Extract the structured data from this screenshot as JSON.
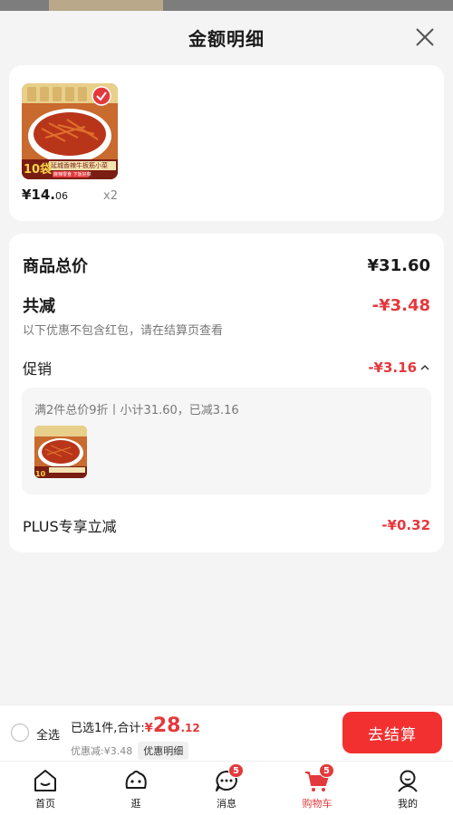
{
  "sheet": {
    "title": "金额明细"
  },
  "product": {
    "image_pack_count": "10袋",
    "image_label": "延城香辣牛板筋小菜",
    "image_sub_label": "麻辣零食 下饭好菜",
    "price_yen": "¥14.",
    "price_decimal": "06",
    "quantity": "x2"
  },
  "summary": {
    "total_label": "商品总价",
    "total_value": "¥31.60",
    "reduce_label": "共减",
    "reduce_value": "-¥3.48",
    "note": "以下优惠不包含红包，请在结算页查看",
    "promo_label": "促销",
    "promo_value": "-¥3.16",
    "promo_detail": "满2件总价9折丨小计31.60，已减3.16",
    "plus_label": "PLUS专享立减",
    "plus_value": "-¥0.32"
  },
  "bottom_bar": {
    "select_all": "全选",
    "total_prefix": "已选1件,合计:",
    "total_yen": "¥",
    "total_int": "28",
    "total_dec": ".12",
    "discount_text": "优惠减:¥3.48",
    "discount_detail": "优惠明细",
    "checkout": "去结算"
  },
  "tabbar": {
    "tabs": [
      {
        "label": "首页",
        "icon": "home-icon"
      },
      {
        "label": "逛",
        "icon": "browse-icon"
      },
      {
        "label": "消息",
        "icon": "message-icon",
        "badge": "5"
      },
      {
        "label": "购物车",
        "icon": "cart-icon",
        "badge": "5",
        "active": true
      },
      {
        "label": "我的",
        "icon": "profile-icon"
      }
    ]
  },
  "colors": {
    "accent_red": "#e4393c",
    "checkout_red": "#f23030"
  }
}
